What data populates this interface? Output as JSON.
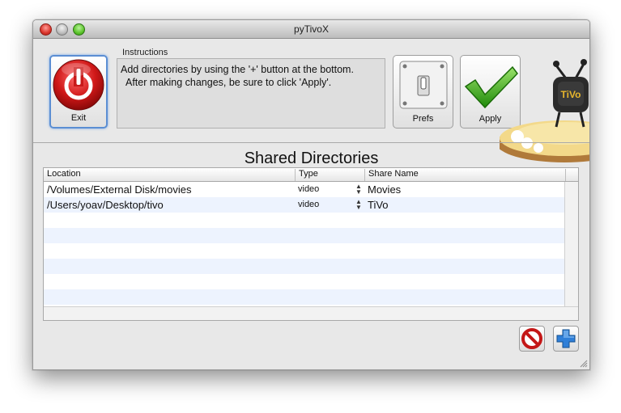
{
  "window": {
    "title": "pyTivoX"
  },
  "toolbar": {
    "exit_label": "Exit",
    "instructions_label": "Instructions",
    "instructions_line1": "Add directories by using the '+' button at the bottom.",
    "instructions_line2": "After making changes, be sure to click 'Apply'.",
    "prefs_label": "Prefs",
    "apply_label": "Apply"
  },
  "shared": {
    "title": "Shared Directories",
    "columns": {
      "location": "Location",
      "type": "Type",
      "share_name": "Share Name"
    },
    "rows": [
      {
        "location": "/Volumes/External Disk/movies",
        "type": "video",
        "share_name": "Movies"
      },
      {
        "location": "/Users/yoav/Desktop/tivo",
        "type": "video",
        "share_name": "TiVo"
      }
    ]
  },
  "icons": {
    "exit": "power-icon",
    "prefs": "switch-icon",
    "apply": "checkmark-icon",
    "remove": "no-entry-icon",
    "add": "plus-icon",
    "mascot": "tivo-mascot-icon"
  },
  "colors": {
    "exit_red": "#cc1b1b",
    "apply_green": "#2f9e12",
    "add_blue": "#2f7fd8",
    "row_alt": "#edf3fe"
  }
}
